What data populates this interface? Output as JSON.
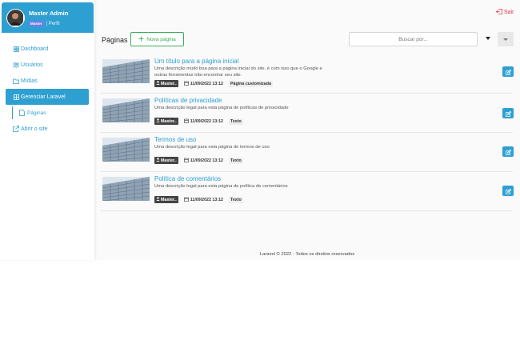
{
  "sidebar": {
    "user_name": "Master Admin",
    "role_badge": "Master",
    "profile_link": "| Perfil",
    "items": [
      {
        "label": "Dashboard",
        "icon": "dashboard-icon"
      },
      {
        "label": "Usuários",
        "icon": "users-icon"
      },
      {
        "label": "Mídias",
        "icon": "folder-icon"
      },
      {
        "label": "Gerenciar Laravel",
        "icon": "grid-icon",
        "active": true
      },
      {
        "label": "Páginas",
        "icon": "file-icon"
      },
      {
        "label": "Abrir o site",
        "icon": "external-link-icon"
      }
    ]
  },
  "topbar": {
    "logout_label": "Sair"
  },
  "header": {
    "title": "Páginas",
    "new_button": "Nova página",
    "search_placeholder": "Buscar por..."
  },
  "pages": [
    {
      "title": "Um título para a página inicial",
      "description": "Uma descrição muito boa para a página inicial do site, é com isso que o Google e outras ferramentas irão encontrar seu site.",
      "author": "Master..",
      "date": "11/09/2022 13:12",
      "type": "Página customizada"
    },
    {
      "title": "Políticas de privacidade",
      "description": "Uma descrição legal para esta página de políticas de privacidade",
      "author": "Master..",
      "date": "11/09/2022 13:12",
      "type": "Texto"
    },
    {
      "title": "Termos de uso",
      "description": "Uma descrição legal para esta página de termos de uso",
      "author": "Master..",
      "date": "11/09/2022 13:12",
      "type": "Texto"
    },
    {
      "title": "Política de comentários",
      "description": "Uma descrição legal para esta página de política de comentários",
      "author": "Master..",
      "date": "11/09/2022 13:12",
      "type": "Texto"
    }
  ],
  "footer": {
    "text": "Laravel © 2022 - Todos os direitos reservados"
  },
  "colors": {
    "primary": "#2e9fd1",
    "success": "#3dab5d",
    "danger": "#e0344e",
    "badge_dark": "#444444"
  }
}
